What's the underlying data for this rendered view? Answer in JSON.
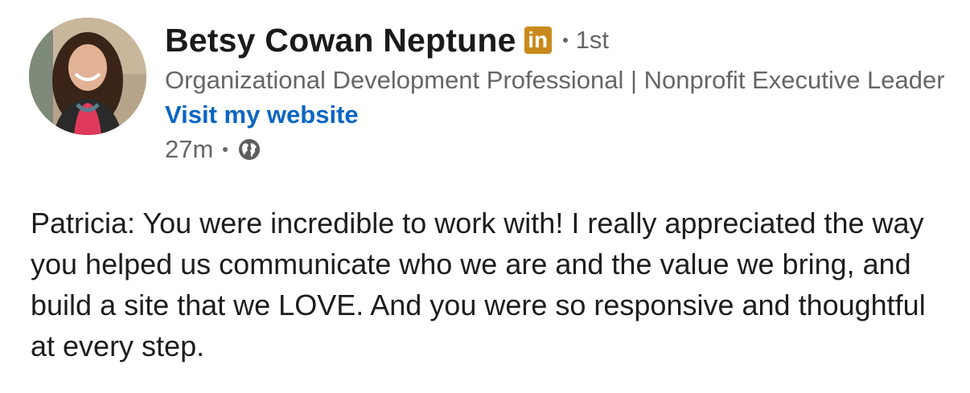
{
  "author": {
    "name": "Betsy Cowan Neptune",
    "badge": "in",
    "degree": "1st",
    "headline": "Organizational Development Professional | Nonprofit Executive Leader",
    "website_label": "Visit my website"
  },
  "meta": {
    "time": "27m",
    "visibility_icon": "globe-icon"
  },
  "post": {
    "text": "Patricia: You were incredible to work with! I really appreciated the way you helped us communicate who we are and the value we bring, and build a site that we LOVE. And you were so responsive and thoughtful at every step."
  },
  "colors": {
    "link": "#0a66c2",
    "premium_badge": "#c98a1b",
    "secondary_text": "#666666"
  }
}
